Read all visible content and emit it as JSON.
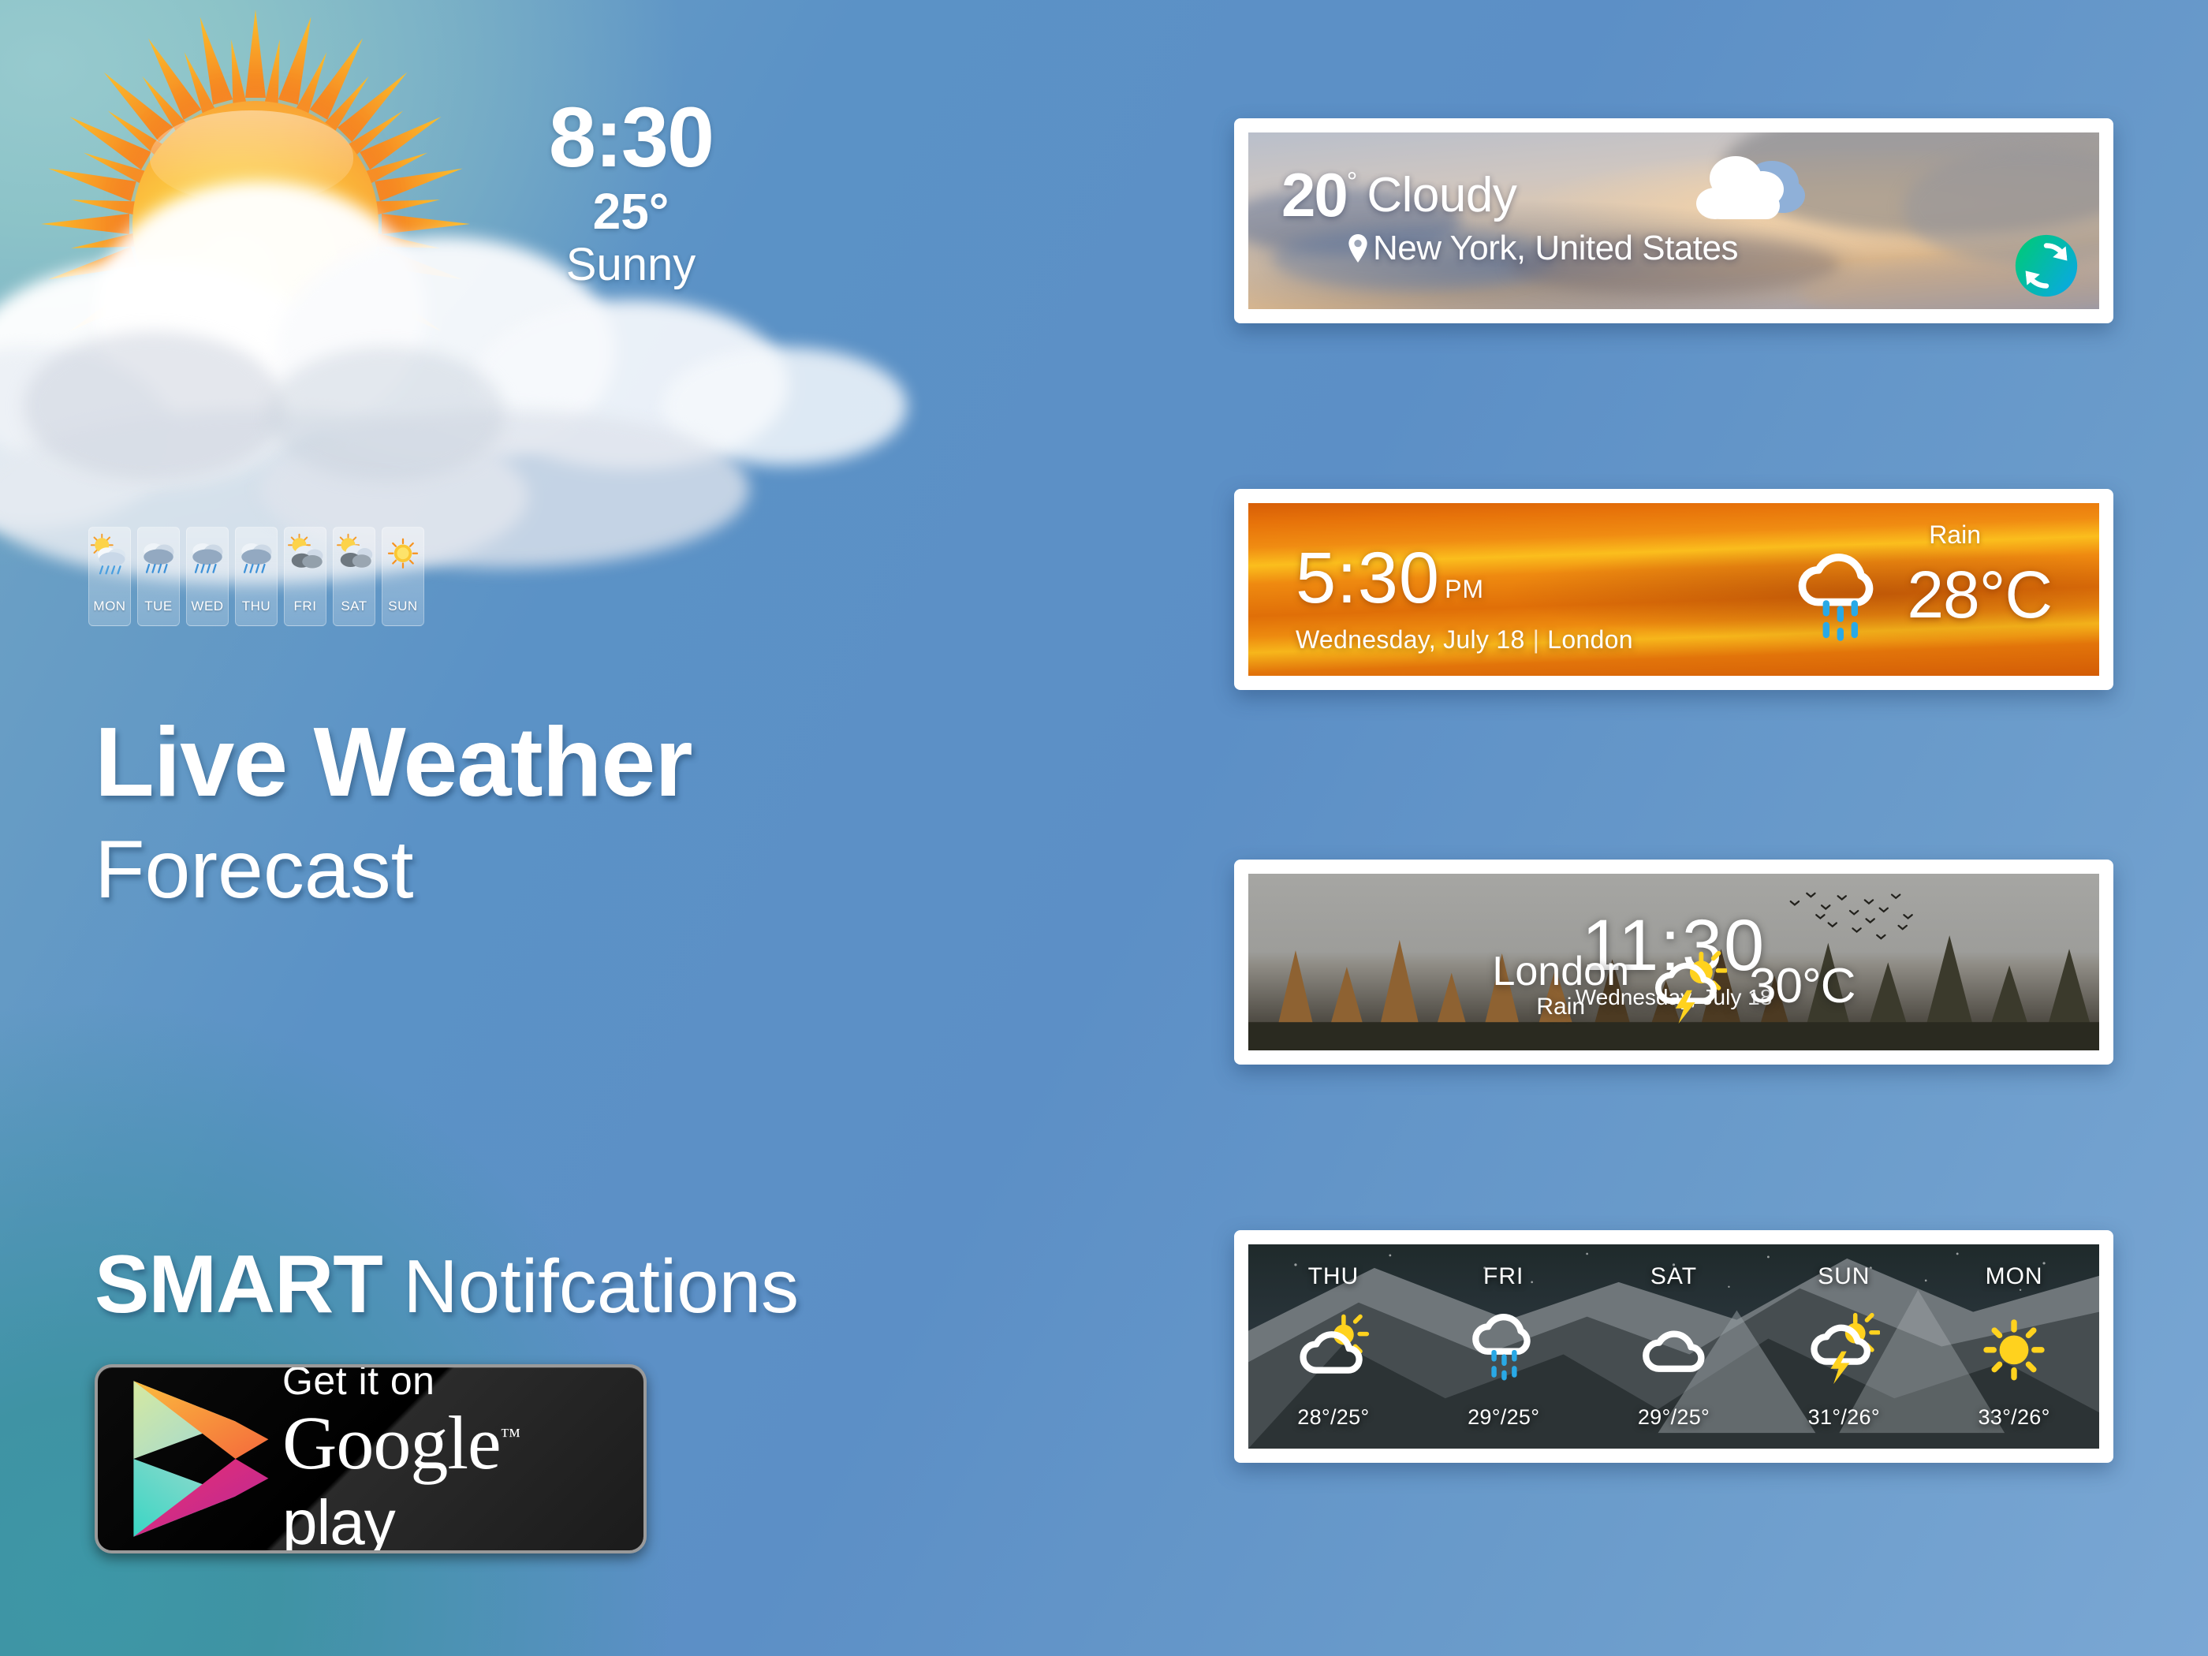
{
  "background": {
    "gradient_from": "#8fc5cb",
    "gradient_teal": "#3d97a6",
    "gradient_blue": "#5b92c6",
    "gradient_to": "#7aa7d4"
  },
  "hero": {
    "sun_icon": "sun-behind-cloud-icon",
    "cloud_icon": "cloud-bank-icon",
    "clock": {
      "time": "8:30",
      "temperature": "25°",
      "condition": "Sunny"
    },
    "headline_main": "Live Weather",
    "headline_sub": "Forecast",
    "smart_bold": "SMART",
    "smart_light": " Notifcations"
  },
  "week_strip": [
    {
      "label": "MON",
      "icon": "sun-cloud-rain-icon"
    },
    {
      "label": "TUE",
      "icon": "cloud-rain-icon"
    },
    {
      "label": "WED",
      "icon": "cloud-rain-icon"
    },
    {
      "label": "THU",
      "icon": "cloud-rain-icon"
    },
    {
      "label": "FRI",
      "icon": "sun-clouds-icon"
    },
    {
      "label": "SAT",
      "icon": "sun-clouds-icon"
    },
    {
      "label": "SUN",
      "icon": "sun-icon"
    }
  ],
  "google_play": {
    "line1": "Get it on",
    "brand": "Google",
    "trademark": "™",
    "play": " play",
    "icon": "google-play-triangle-icon"
  },
  "cards": {
    "card1": {
      "name": "cloudy-new-york-widget",
      "temperature": "20",
      "degree": "°",
      "condition": "Cloudy",
      "location": "New York, United States",
      "location_pin_icon": "map-pin-icon",
      "weather_icon": "cloud-icon",
      "refresh_icon": "refresh-icon",
      "refresh_color_start": "#00c97a",
      "refresh_color_end": "#0aa7e8"
    },
    "card2": {
      "name": "london-sunset-widget",
      "time": "5:30",
      "meridiem": "PM",
      "date": "Wednesday, July 18",
      "separator": "|",
      "city": "London",
      "condition": "Rain",
      "temperature": "28°C",
      "weather_icon": "cloud-rain-icon",
      "accent": "#e8780c",
      "rain_drop_color": "#29a9e6"
    },
    "card3": {
      "name": "london-forest-widget",
      "time": "11:30",
      "date": "Wednesday, July 18",
      "city": "London",
      "condition": "Rain",
      "temperature": "30°C",
      "weather_icon": "sun-cloud-thunder-icon",
      "bolt_color": "#ffd21e"
    },
    "card4": {
      "name": "five-day-forecast-widget",
      "days": [
        {
          "label": "THU",
          "icon": "sun-cloud-icon",
          "temps": "28°/25°"
        },
        {
          "label": "FRI",
          "icon": "cloud-rain-icon",
          "temps": "29°/25°"
        },
        {
          "label": "SAT",
          "icon": "cloud-icon",
          "temps": "29°/25°"
        },
        {
          "label": "SUN",
          "icon": "sun-cloud-thunder-icon",
          "temps": "31°/26°"
        },
        {
          "label": "MON",
          "icon": "sun-icon",
          "temps": "33°/26°"
        }
      ]
    }
  }
}
